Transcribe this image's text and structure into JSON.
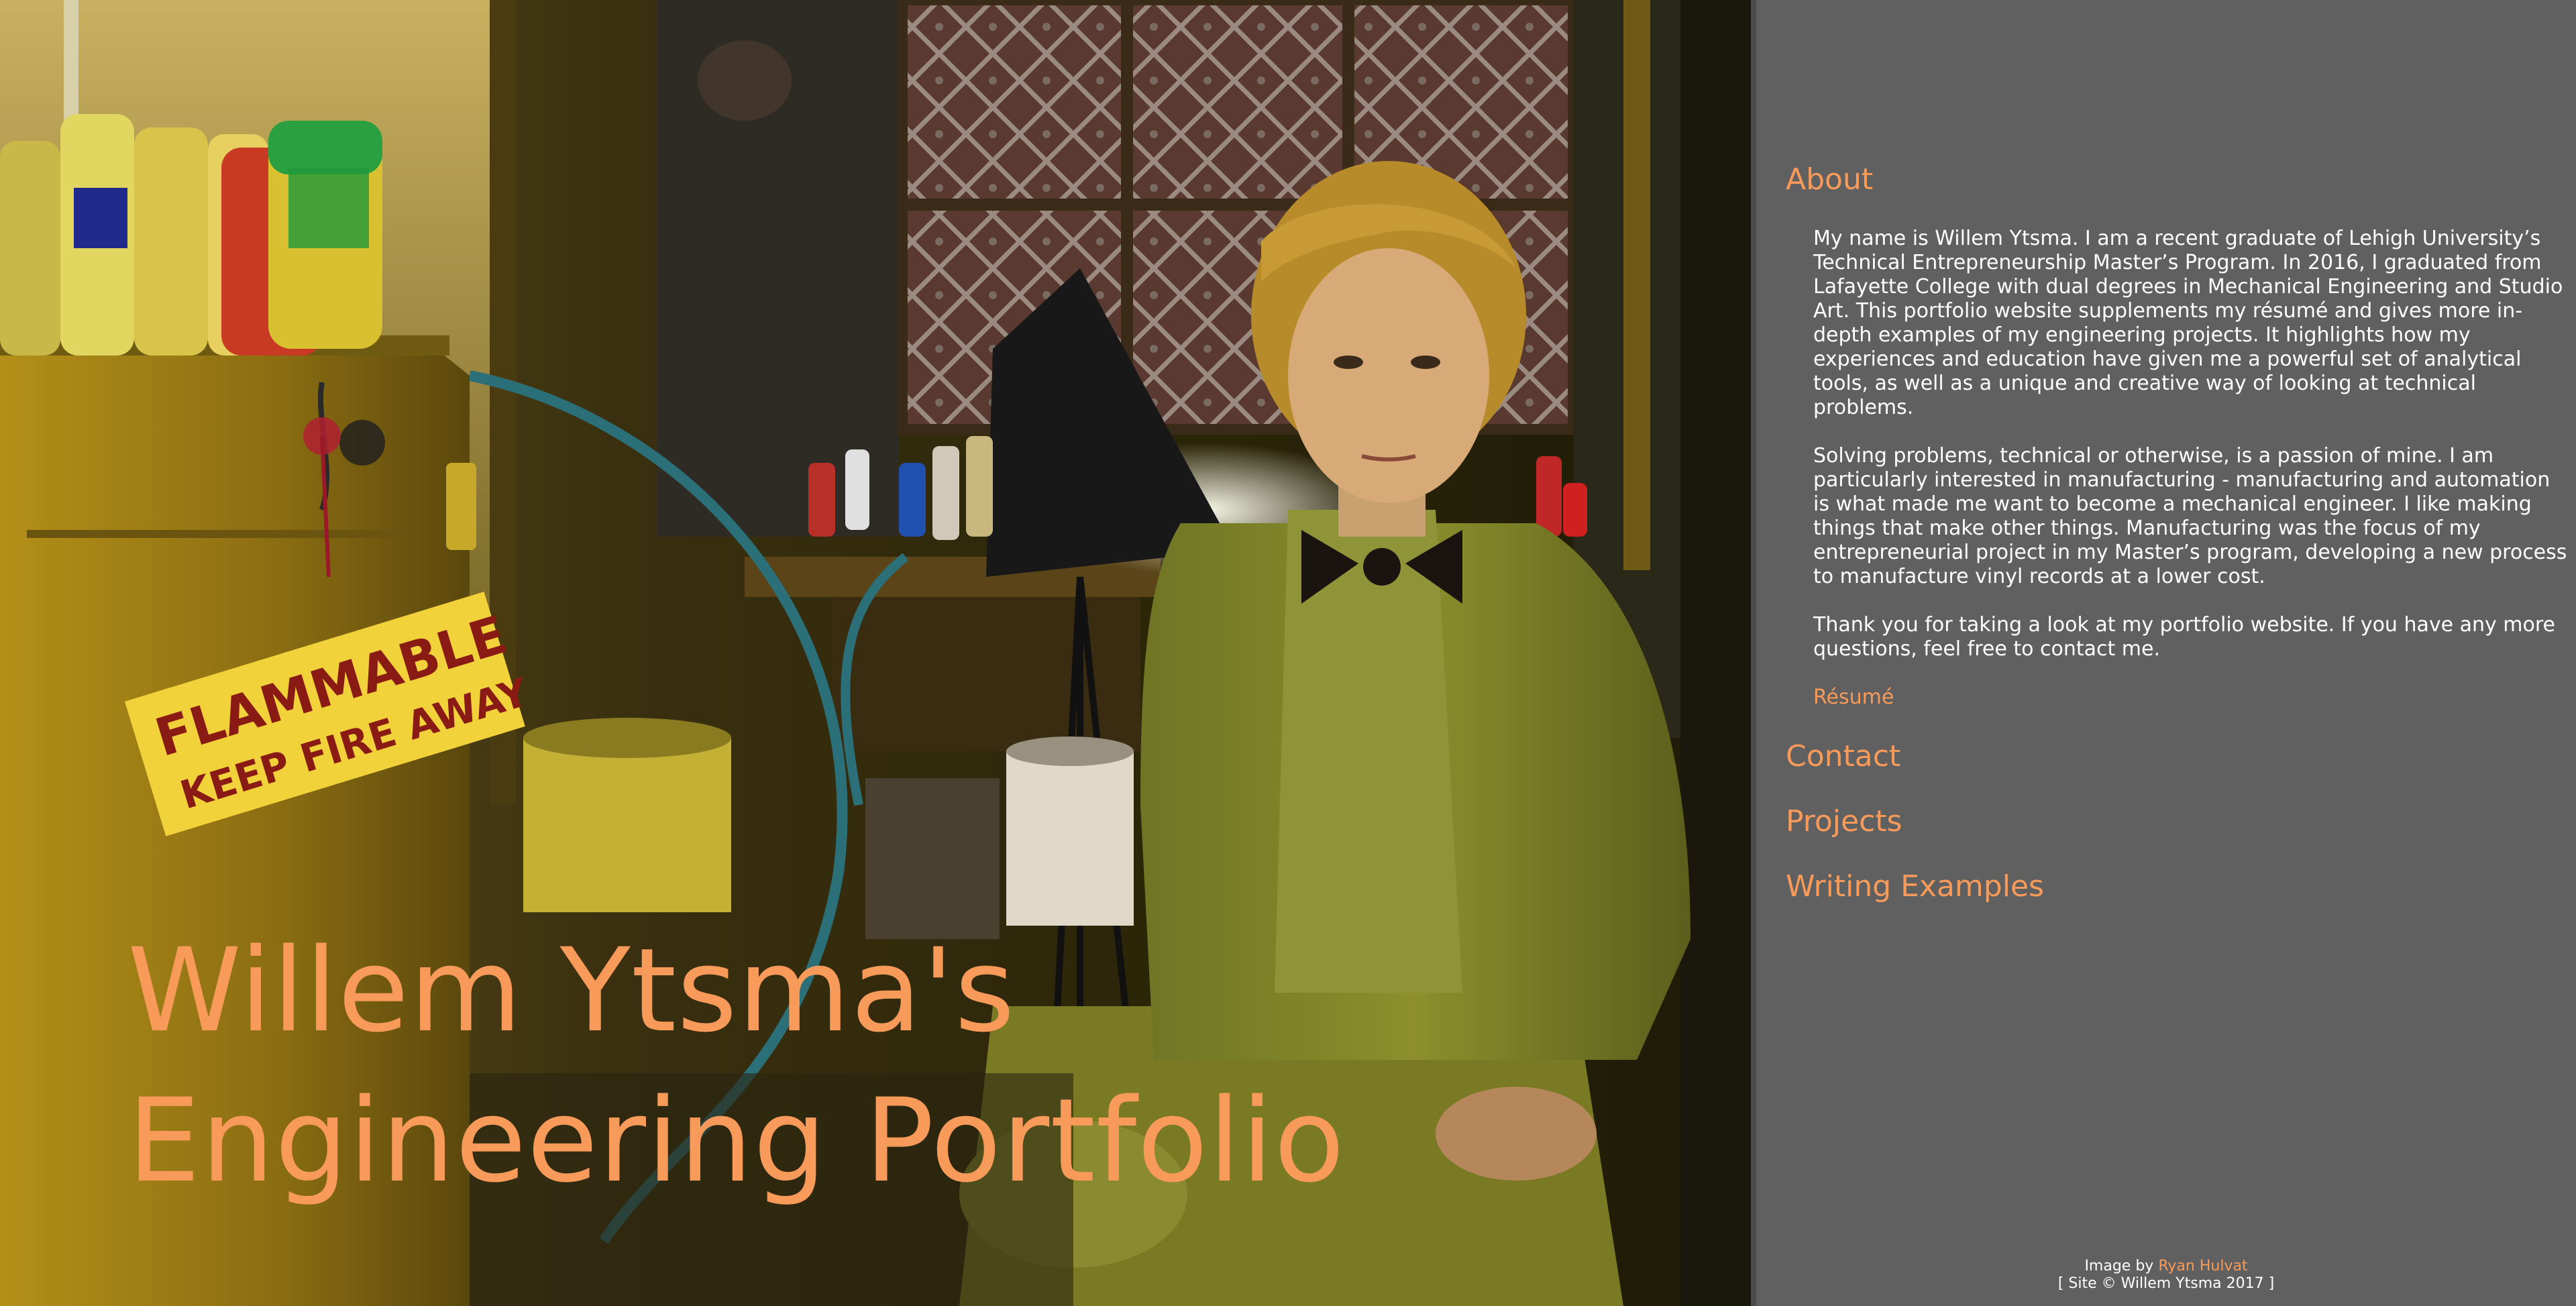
{
  "hero": {
    "line1": "Willem Ytsma's",
    "line2": "Engineering Portfolio"
  },
  "colors": {
    "accent": "#f79a5a",
    "panel_background": "#606060",
    "text": "#ffffff"
  },
  "background_image": {
    "sign_line1": "FLAMMABLE",
    "sign_line2": "KEEP FIRE AWAY"
  },
  "nav": {
    "about": "About",
    "contact": "Contact",
    "projects": "Projects",
    "writing": "Writing Examples"
  },
  "about": {
    "paragraphs": [
      "My name is Willem Ytsma. I am a recent graduate of Lehigh University’s Technical Entrepreneurship Master’s Program. In 2016, I graduated from Lafayette College with dual degrees in Mechanical Engineering and Studio Art. This portfolio website supplements my résumé and gives more in-depth examples of my engineering projects. It highlights how my experiences and education have given me a powerful set of analytical tools, as well as a unique and creative way of looking at technical problems.",
      "Solving problems, technical or otherwise, is a passion of mine. I am particularly interested in manufacturing - manufacturing and automation is what made me want to become a mechanical engineer. I like making things that make other things. Manufacturing was the focus of my entrepreneurial project in my Master’s program, developing a new process to manufacture vinyl records at a lower cost.",
      "Thank you for taking a look at my portfolio website. If you have any more questions, feel free to contact me."
    ],
    "resume_link": "Résumé"
  },
  "footer": {
    "image_credit_prefix": "Image by ",
    "image_credit_name": "Ryan Hulvat",
    "copyright": "[ Site © Willem Ytsma 2017 ]"
  }
}
